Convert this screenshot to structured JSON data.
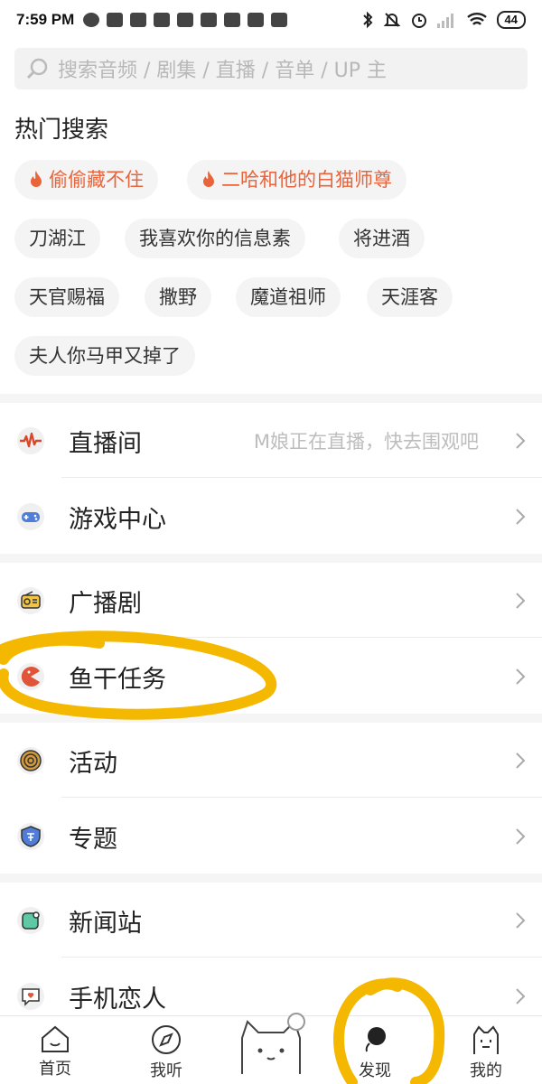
{
  "status_bar": {
    "time": "7:59 PM",
    "battery": "44"
  },
  "search": {
    "placeholder": "搜索音频 / 剧集 / 直播 / 音单 / UP 主"
  },
  "hot_search": {
    "title": "热门搜索",
    "chips": [
      "偷偷藏不住",
      "二哈和他的白猫师尊",
      "刀湖江",
      "我喜欢你的信息素",
      "将进酒",
      "天官赐福",
      "撒野",
      "魔道祖师",
      "天涯客",
      "夫人你马甲又掉了"
    ]
  },
  "menu": {
    "live": {
      "label": "直播间",
      "hint": "M娘正在直播，快去围观吧"
    },
    "game": {
      "label": "游戏中心"
    },
    "drama": {
      "label": "广播剧"
    },
    "task": {
      "label": "鱼干任务"
    },
    "activity": {
      "label": "活动"
    },
    "topic": {
      "label": "专题"
    },
    "news": {
      "label": "新闻站"
    },
    "phone_lover": {
      "label": "手机恋人"
    }
  },
  "bottom_nav": {
    "home": "首页",
    "listen": "我听",
    "discover": "发现",
    "mine": "我的"
  },
  "colors": {
    "accent": "#e9643b",
    "highlight": "#f5b800"
  }
}
